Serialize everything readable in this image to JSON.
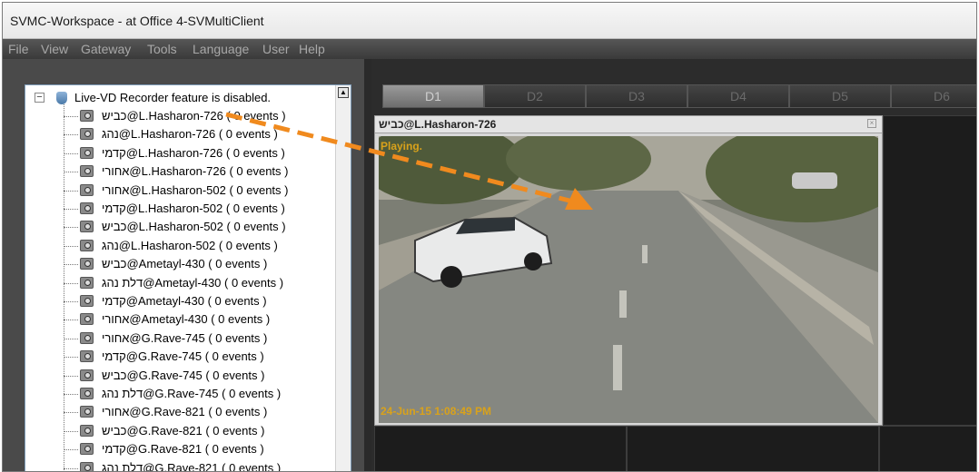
{
  "window": {
    "title": "SVMC-Workspace - at Office 4-SVMultiClient"
  },
  "menu": [
    "File",
    "View",
    "Gateway",
    "Tools",
    "Language",
    "User",
    "Help"
  ],
  "tree": {
    "root_label": "Live-VD Recorder feature is disabled.",
    "items": [
      "כביש@L.Hasharon-726 ( 0 events )",
      "נהג@L.Hasharon-726 ( 0 events )",
      "קדמי@L.Hasharon-726 ( 0 events )",
      "אחורי@L.Hasharon-726 ( 0 events )",
      "אחורי@L.Hasharon-502 ( 0 events )",
      "קדמי@L.Hasharon-502 ( 0 events )",
      "כביש@L.Hasharon-502 ( 0 events )",
      "נהג@L.Hasharon-502 ( 0 events )",
      "כביש@Ametayl-430 ( 0 events )",
      "דלת נהג@Ametayl-430 ( 0 events )",
      "קדמי@Ametayl-430 ( 0 events )",
      "אחורי@Ametayl-430 ( 0 events )",
      "אחורי@G.Rave-745 ( 0 events )",
      "קדמי@G.Rave-745 ( 0 events )",
      "כביש@G.Rave-745 ( 0 events )",
      "דלת נהג@G.Rave-745 ( 0 events )",
      "אחורי@G.Rave-821 ( 0 events )",
      "כביש@G.Rave-821 ( 0 events )",
      "קדמי@G.Rave-821 ( 0 events )",
      "דלת נהג@G.Rave-821 ( 0 events )"
    ]
  },
  "tabs": [
    "D1",
    "D2",
    "D3",
    "D4",
    "D5",
    "D6"
  ],
  "video": {
    "title": "כביש@L.Hasharon-726",
    "status": "Playing.",
    "timestamp": "24-Jun-15 1:08:49 PM"
  },
  "colors": {
    "annotation_arrow": "#f08a1e",
    "overlay_text": "#d9a21b"
  }
}
